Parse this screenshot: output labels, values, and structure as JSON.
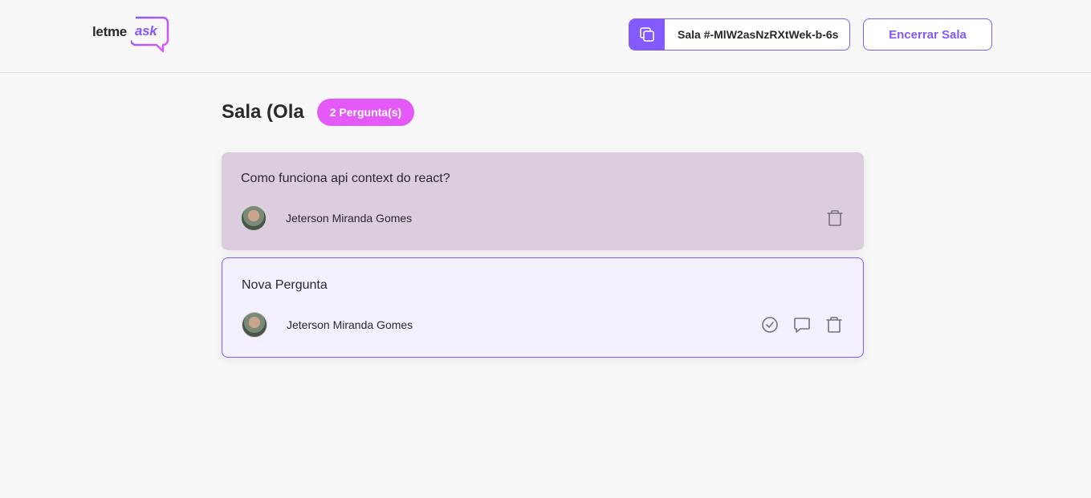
{
  "header": {
    "logo": {
      "part1": "letme",
      "part2": "ask"
    },
    "room_code": {
      "label": "Sala #-MlW2asNzRXtWek-b-6s"
    },
    "close_button_label": "Encerrar Sala"
  },
  "main": {
    "title": "Sala (Ola",
    "question_count": "2 Pergunta(s)"
  },
  "questions": [
    {
      "content": "Como funciona api context do react?",
      "author": "Jeterson Miranda Gomes",
      "highlighted": true
    },
    {
      "content": "Nova Pergunta",
      "author": "Jeterson Miranda Gomes",
      "highlighted": false
    }
  ],
  "colors": {
    "accent": "#835afd",
    "badge": "#e559f9",
    "answered_bg": "#dbcddd",
    "highlight_bg": "#f4f0ff",
    "icon": "#737380"
  }
}
